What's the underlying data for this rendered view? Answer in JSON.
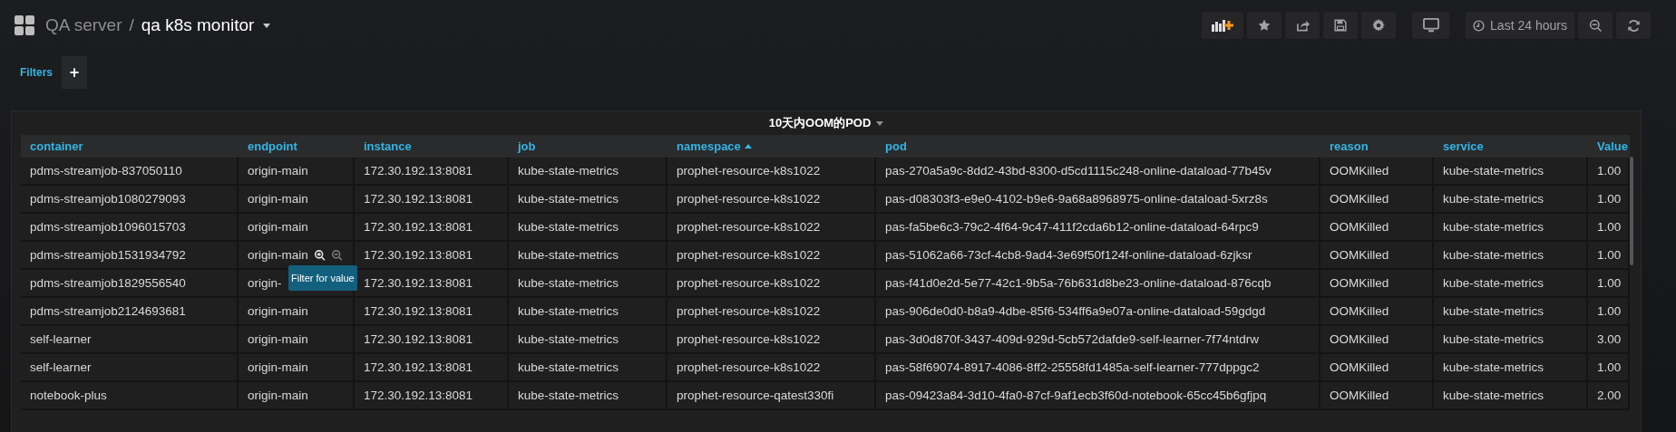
{
  "breadcrumb": {
    "folder": "QA server",
    "separator": "/",
    "dashboard": "qa k8s monitor"
  },
  "toolbar": {
    "time_range": "Last 24 hours"
  },
  "filters": {
    "label": "Filters",
    "add": "+"
  },
  "panel": {
    "title": "10天内OOM的POD",
    "columns": [
      {
        "label": "container",
        "sorted_asc": false
      },
      {
        "label": "endpoint",
        "sorted_asc": false
      },
      {
        "label": "instance",
        "sorted_asc": false
      },
      {
        "label": "job",
        "sorted_asc": false
      },
      {
        "label": "namespace",
        "sorted_asc": true
      },
      {
        "label": "pod",
        "sorted_asc": false
      },
      {
        "label": "reason",
        "sorted_asc": false
      },
      {
        "label": "service",
        "sorted_asc": false
      },
      {
        "label": "Value",
        "sorted_asc": false
      }
    ],
    "rows": [
      {
        "hovered": false,
        "cells": [
          "pdms-streamjob-837050110",
          "origin-main",
          "172.30.192.13:8081",
          "kube-state-metrics",
          "prophet-resource-k8s1022",
          "pas-270a5a9c-8dd2-43bd-8300-d5cd1115c248-online-dataload-77b45v",
          "OOMKilled",
          "kube-state-metrics",
          "1.00"
        ]
      },
      {
        "hovered": false,
        "cells": [
          "pdms-streamjob1080279093",
          "origin-main",
          "172.30.192.13:8081",
          "kube-state-metrics",
          "prophet-resource-k8s1022",
          "pas-d08303f3-e9e0-4102-b9e6-9a68a8968975-online-dataload-5xrz8s",
          "OOMKilled",
          "kube-state-metrics",
          "1.00"
        ]
      },
      {
        "hovered": false,
        "cells": [
          "pdms-streamjob1096015703",
          "origin-main",
          "172.30.192.13:8081",
          "kube-state-metrics",
          "prophet-resource-k8s1022",
          "pas-fa5be6c3-79c2-4f64-9c47-411f2cda6b12-online-dataload-64rpc9",
          "OOMKilled",
          "kube-state-metrics",
          "1.00"
        ]
      },
      {
        "hovered": true,
        "tooltip": "Filter for value",
        "cells": [
          "pdms-streamjob1531934792",
          "origin-main",
          "172.30.192.13:8081",
          "kube-state-metrics",
          "prophet-resource-k8s1022",
          "pas-51062a66-73cf-4cb8-9ad4-3e69f50f124f-online-dataload-6zjksr",
          "OOMKilled",
          "kube-state-metrics",
          "1.00"
        ]
      },
      {
        "hovered": false,
        "cells": [
          "pdms-streamjob1829556540",
          "origin-",
          "172.30.192.13:8081",
          "kube-state-metrics",
          "prophet-resource-k8s1022",
          "pas-f41d0e2d-5e77-42c1-9b5a-76b631d8be23-online-dataload-876cqb",
          "OOMKilled",
          "kube-state-metrics",
          "1.00"
        ]
      },
      {
        "hovered": false,
        "cells": [
          "pdms-streamjob2124693681",
          "origin-main",
          "172.30.192.13:8081",
          "kube-state-metrics",
          "prophet-resource-k8s1022",
          "pas-906de0d0-b8a9-4dbe-85f6-534ff6a9e07a-online-dataload-59gdgd",
          "OOMKilled",
          "kube-state-metrics",
          "1.00"
        ]
      },
      {
        "hovered": false,
        "cells": [
          "self-learner",
          "origin-main",
          "172.30.192.13:8081",
          "kube-state-metrics",
          "prophet-resource-k8s1022",
          "pas-3d0d870f-3437-409d-929d-5cb572dafde9-self-learner-7f74ntdrw",
          "OOMKilled",
          "kube-state-metrics",
          "3.00"
        ]
      },
      {
        "hovered": false,
        "cells": [
          "self-learner",
          "origin-main",
          "172.30.192.13:8081",
          "kube-state-metrics",
          "prophet-resource-k8s1022",
          "pas-58f69074-8917-4086-8ff2-25558fd1485a-self-learner-777dppgc2",
          "OOMKilled",
          "kube-state-metrics",
          "1.00"
        ]
      },
      {
        "hovered": false,
        "cells": [
          "notebook-plus",
          "origin-main",
          "172.30.192.13:8081",
          "kube-state-metrics",
          "prophet-resource-qatest330fi",
          "pas-09423a84-3d10-4fa0-87cf-9af1ecb3f60d-notebook-65cc45b6gfjpq",
          "OOMKilled",
          "kube-state-metrics",
          "2.00"
        ]
      }
    ]
  }
}
